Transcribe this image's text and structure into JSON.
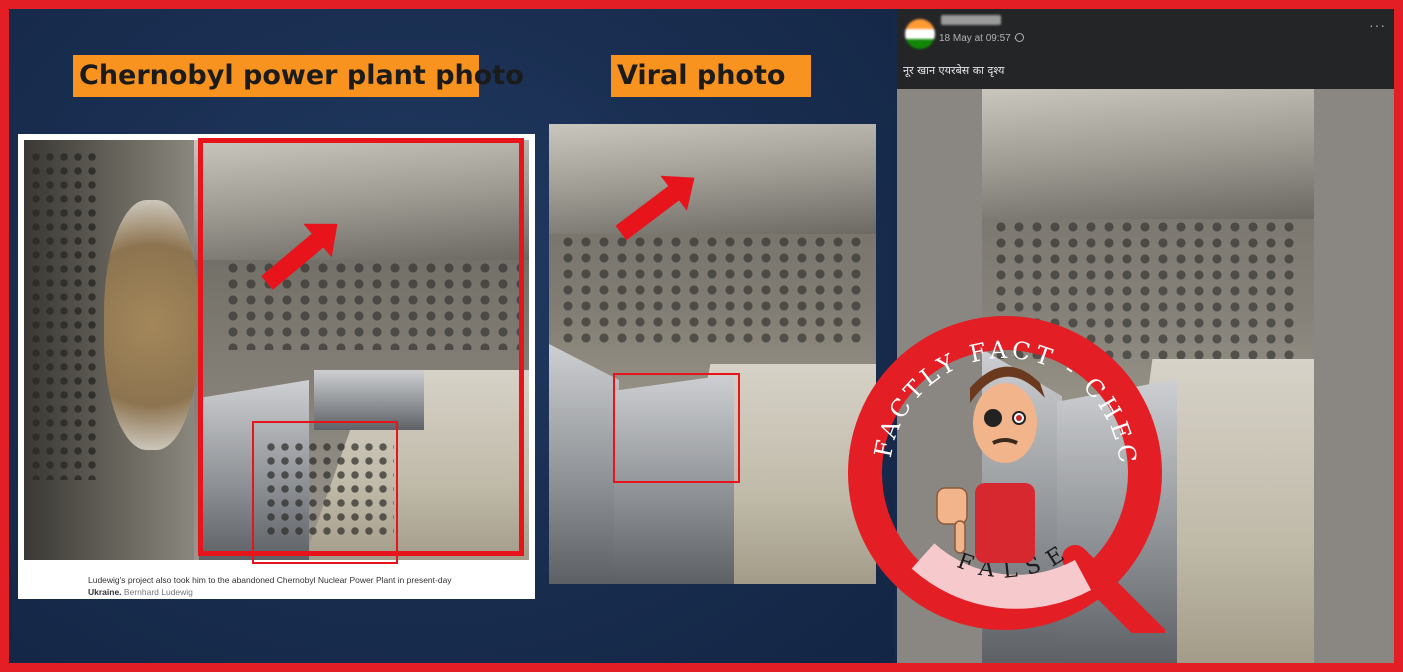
{
  "labels": {
    "chernobyl": "Chernobyl power plant photo",
    "viral": "Viral photo"
  },
  "caption": {
    "text": "Ludewig's project also took him to the abandoned Chernobyl Nuclear Power Plant in present-day",
    "bold": "Ukraine.",
    "credit": "Bernhard Ludewig"
  },
  "facebook": {
    "timestamp": "18 May at 09:57 ·",
    "post_text": "नूर खान एयरबेस का दृश्य",
    "more": "···"
  },
  "stamp": {
    "arc_text": "FACTLY FACT - CHECK",
    "verdict": "FALSE"
  },
  "colors": {
    "frame": "#e31e24",
    "label_bg": "#f7931e",
    "highlight": "#e8141b",
    "fb_header": "#242526"
  },
  "icons": [
    "arrow-icon",
    "globe-icon",
    "more-icon",
    "magnifier-icon",
    "thumbs-down-icon"
  ]
}
